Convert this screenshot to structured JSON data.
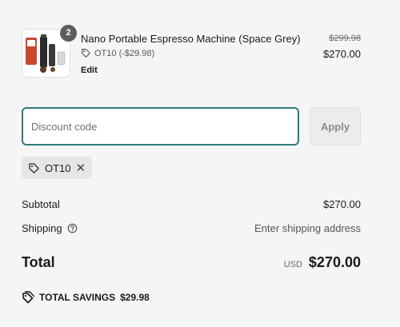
{
  "product": {
    "quantity": "2",
    "name": "Nano Portable Espresso Machine (Space Grey)",
    "discount_label": "OT10 (-$29.98)",
    "edit_label": "Edit",
    "original_price": "$299.98",
    "price": "$270.00",
    "image_icon": "espresso-machine-product-image"
  },
  "discount": {
    "placeholder": "Discount code",
    "value": "",
    "apply_label": "Apply",
    "applied_code": "OT10"
  },
  "summary": {
    "subtotal_label": "Subtotal",
    "subtotal_value": "$270.00",
    "shipping_label": "Shipping",
    "shipping_value": "Enter shipping address",
    "total_label": "Total",
    "currency": "USD",
    "total_value": "$270.00",
    "savings_label": "TOTAL SAVINGS",
    "savings_value": "$29.98"
  },
  "colors": {
    "input_border_focus": "#2f7a80",
    "badge": "#5c5c5c",
    "background": "#f5f5f5"
  }
}
